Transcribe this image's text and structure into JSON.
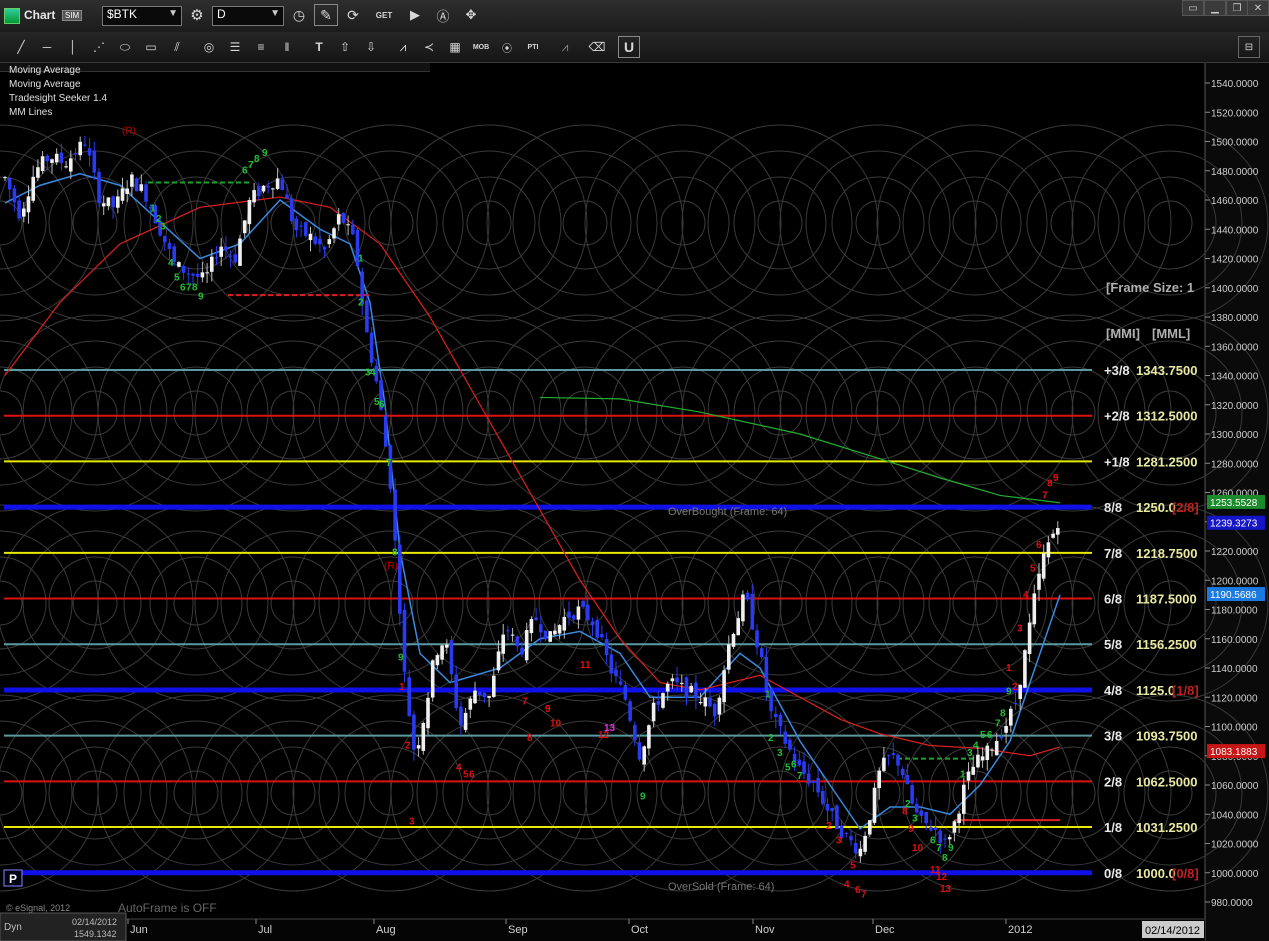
{
  "titlebar": {
    "app_label": "Chart",
    "sim_badge": "SIM",
    "symbol": "$BTK",
    "interval": "D"
  },
  "studies": [
    "Moving Average",
    "Moving Average",
    "Tradesight Seeker 1.4",
    "MM Lines"
  ],
  "price_axis": {
    "min": 980,
    "max": 1540,
    "labels": [
      "1540.0000",
      "1520.0000",
      "1500.0000",
      "1480.0000",
      "1460.0000",
      "1440.0000",
      "1420.0000",
      "1400.0000",
      "1380.0000",
      "1360.0000",
      "1340.0000",
      "1320.0000",
      "1300.0000",
      "1280.0000",
      "1260.0000",
      "1240.0000",
      "1220.0000",
      "1200.0000",
      "1180.0000",
      "1160.0000",
      "1140.0000",
      "1120.0000",
      "1100.0000",
      "1080.0000",
      "1060.0000",
      "1040.0000",
      "1020.0000",
      "1000.0000",
      "980.0000"
    ],
    "badges": [
      {
        "text": "1253.5528",
        "color": "#1a8a2a",
        "value": 1253.55
      },
      {
        "text": "1239.3273",
        "color": "#1515c8",
        "value": 1239.33
      },
      {
        "text": "1190.5686",
        "color": "#1a7ae0",
        "value": 1190.57
      },
      {
        "text": "1083.1883",
        "color": "#c81515",
        "value": 1083.19
      }
    ]
  },
  "time_axis": {
    "labels": [
      "Jun",
      "Jul",
      "Aug",
      "Sep",
      "Oct",
      "Nov",
      "Dec",
      "2012"
    ],
    "date_badge": "02/14/2012"
  },
  "murrey_lines": [
    {
      "label": "+3/8",
      "price": 1343.75,
      "text": "1343.7500",
      "color": "#5a9aa0",
      "suffix": ""
    },
    {
      "label": "+2/8",
      "price": 1312.5,
      "text": "1312.5000",
      "color": "#e01010",
      "suffix": ""
    },
    {
      "label": "+1/8",
      "price": 1281.25,
      "text": "1281.2500",
      "color": "#e8e800",
      "suffix": ""
    },
    {
      "label": "8/8",
      "price": 1250,
      "text": "1250.0",
      "color": "#1010e8",
      "suffix": "[2/8]"
    },
    {
      "label": "7/8",
      "price": 1218.75,
      "text": "1218.7500",
      "color": "#e8e800",
      "suffix": ""
    },
    {
      "label": "6/8",
      "price": 1187.5,
      "text": "1187.5000",
      "color": "#e01010",
      "suffix": ""
    },
    {
      "label": "5/8",
      "price": 1156.25,
      "text": "1156.2500",
      "color": "#5a9aa0",
      "suffix": ""
    },
    {
      "label": "4/8",
      "price": 1125,
      "text": "1125.0",
      "color": "#1010e8",
      "suffix": "[1/8]"
    },
    {
      "label": "3/8",
      "price": 1093.75,
      "text": "1093.7500",
      "color": "#5a9aa0",
      "suffix": ""
    },
    {
      "label": "2/8",
      "price": 1062.5,
      "text": "1062.5000",
      "color": "#e01010",
      "suffix": ""
    },
    {
      "label": "1/8",
      "price": 1031.25,
      "text": "1031.2500",
      "color": "#e8e800",
      "suffix": ""
    },
    {
      "label": "0/8",
      "price": 1000,
      "text": "1000.0",
      "color": "#1010e8",
      "suffix": "[0/8]"
    }
  ],
  "annotations": {
    "frame_size": "[Frame Size: 1",
    "mmi": "[MMI]",
    "mml": "[MML]",
    "overbought": "OverBought (Frame: 64)",
    "oversold": "OverSold (Frame: 64)",
    "autoframe": "AutoFrame is OFF",
    "copyright": "© eSignal, 2012",
    "r_marker": "(R)",
    "p_button": "P",
    "cursor_date": "02/14/2012",
    "cursor_price": "1549.1342",
    "dyn": "Dyn"
  }
}
